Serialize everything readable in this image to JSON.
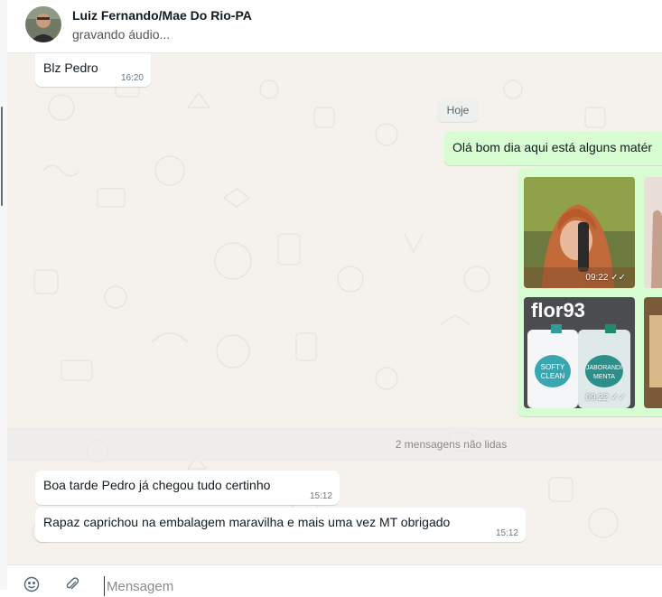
{
  "header": {
    "contact_name": "Luiz Fernando/Mae Do Rio-PA",
    "status": "gravando áudio..."
  },
  "messages": {
    "first": {
      "text": "Blz Pedro",
      "time": "16:20"
    },
    "day_chip": "Hoje",
    "outgoing_text": {
      "text": "Olá bom dia aqui está alguns matér"
    },
    "media": [
      {
        "time": "09:22",
        "status_icon": "double-check-icon"
      },
      {
        "time": "09:22",
        "status_icon": "double-check-icon"
      }
    ],
    "unread_divider": "2 mensagens não lidas",
    "incoming": [
      {
        "text": "Boa tarde Pedro já chegou tudo certinho",
        "time": "15:12"
      },
      {
        "text": "Rapaz caprichou na embalagem maravilha e mais uma vez MT obrigado",
        "time": "15:12"
      }
    ]
  },
  "composer": {
    "placeholder": "Mensagem",
    "left_icons": [
      "emoji-icon",
      "attach-icon"
    ]
  },
  "colors": {
    "outgoing_bubble": "#d9fdd3",
    "incoming_bubble": "#ffffff",
    "chat_bg": "#f5f2ee"
  }
}
